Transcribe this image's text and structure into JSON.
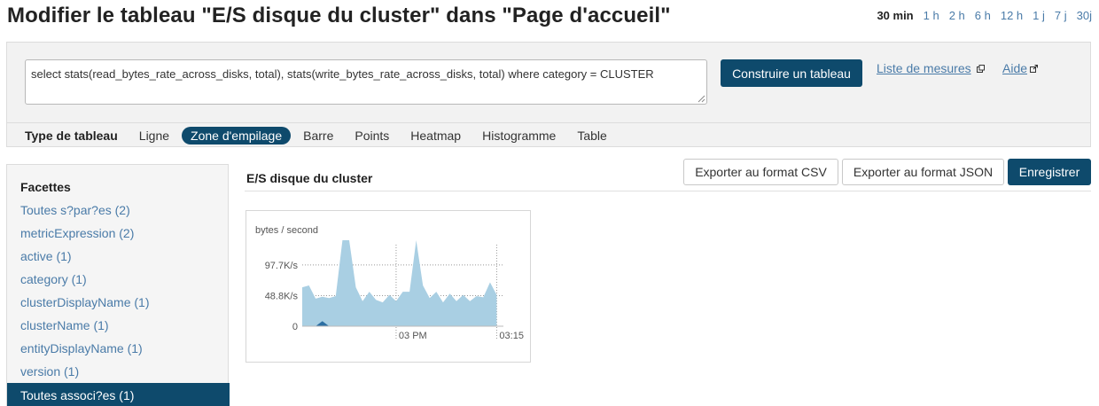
{
  "page": {
    "title": "Modifier le tableau \"E/S disque du cluster\" dans \"Page d'accueil\""
  },
  "time_range": {
    "options": [
      "30 min",
      "1 h",
      "2 h",
      "6 h",
      "12 h",
      "1 j",
      "7 j",
      "30j"
    ],
    "selected": "30 min"
  },
  "query": {
    "text": "select stats(read_bytes_rate_across_disks, total), stats(write_bytes_rate_across_disks, total) where category = CLUSTER",
    "build_button": "Construire un tableau",
    "metrics_link": "Liste de mesures",
    "help_link": "Aide"
  },
  "chart_type": {
    "label": "Type de tableau",
    "options": [
      "Ligne",
      "Zone d'empilage",
      "Barre",
      "Points",
      "Heatmap",
      "Histogramme",
      "Table"
    ],
    "selected": "Zone d'empilage"
  },
  "facets": {
    "title": "Facettes",
    "items": [
      "Toutes s?par?es (2)",
      "metricExpression (2)",
      "active (1)",
      "category (1)",
      "clusterDisplayName (1)",
      "clusterName (1)",
      "entityDisplayName (1)",
      "version (1)"
    ],
    "selected": "Toutes associ?es (1)"
  },
  "panel": {
    "title": "E/S disque du cluster",
    "export_csv": "Exporter au format CSV",
    "export_json": "Exporter au format JSON",
    "save": "Enregistrer"
  },
  "colors": {
    "primary": "#0e4a6c",
    "link": "#4a7ba8",
    "series_read": "#a9cfe3",
    "series_write": "#2c6fa3"
  },
  "chart_data": {
    "type": "area",
    "stacked": true,
    "ylabel": "bytes / second",
    "y_ticks": [
      {
        "value": 0,
        "label": "0"
      },
      {
        "value": 48.8,
        "label": "48.8K/s"
      },
      {
        "value": 97.7,
        "label": "97.7K/s"
      }
    ],
    "x_ticks": [
      {
        "minute": 14,
        "label": "03 PM"
      },
      {
        "minute": 29,
        "label": "03:15"
      }
    ],
    "ylim": [
      0,
      130
    ],
    "xlim": [
      0,
      30
    ],
    "grid": true,
    "series": [
      {
        "values": [
          [
            0,
            62
          ],
          [
            1,
            65
          ],
          [
            2,
            44
          ],
          [
            3,
            47
          ],
          [
            4,
            45
          ],
          [
            5,
            48
          ],
          [
            6,
            137
          ],
          [
            7,
            137
          ],
          [
            8,
            62
          ],
          [
            9,
            40
          ],
          [
            10,
            55
          ],
          [
            11,
            42
          ],
          [
            12,
            38
          ],
          [
            13,
            50
          ],
          [
            14,
            40
          ],
          [
            15,
            55
          ],
          [
            16,
            55
          ],
          [
            17,
            137
          ],
          [
            18,
            65
          ],
          [
            19,
            45
          ],
          [
            20,
            55
          ],
          [
            21,
            38
          ],
          [
            22,
            52
          ],
          [
            23,
            40
          ],
          [
            24,
            50
          ],
          [
            25,
            40
          ],
          [
            26,
            48
          ],
          [
            27,
            46
          ],
          [
            28,
            70
          ],
          [
            29,
            50
          ]
        ]
      },
      {
        "values": [
          [
            0,
            0
          ],
          [
            2,
            0
          ],
          [
            3,
            8
          ],
          [
            4,
            0
          ],
          [
            29,
            0
          ]
        ]
      }
    ]
  }
}
